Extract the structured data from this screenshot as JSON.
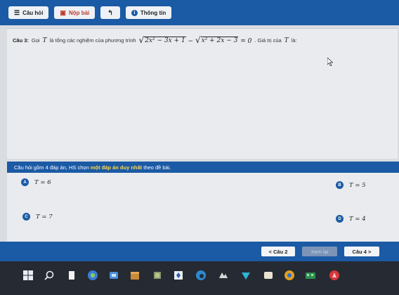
{
  "toolbar": {
    "questions_label": "Câu hỏi",
    "submit_label": "Nộp bài",
    "info_label": "Thông tin"
  },
  "question": {
    "number": "Câu 3:",
    "prefix": "Gọi",
    "var": "T",
    "middle": "là tổng các nghiệm của phương trình",
    "radicand1": "2x² − 3x + 1",
    "minus": " − ",
    "radicand2": "x² + 2x − 3",
    "equals": " = 0",
    "suffix": ". Giá trị của",
    "end": "là:"
  },
  "instruction": {
    "before": "Câu hỏi gồm 4 đáp án, HS chọn",
    "highlight": "một đáp án duy nhất",
    "after": "theo đề bài."
  },
  "answers": [
    {
      "label": "A",
      "value": "T = 6"
    },
    {
      "label": "B",
      "value": "T = 5"
    },
    {
      "label": "C",
      "value": "T = 7"
    },
    {
      "label": "D",
      "value": "T = 4"
    }
  ],
  "nav": {
    "prev_label": "< Câu 2",
    "review_label": "Xem lại",
    "next_label": "Câu 4 >"
  },
  "colors": {
    "primary_blue": "#1b5aa5",
    "highlight_yellow": "#ffd84a",
    "submit_red": "#c0392b"
  }
}
